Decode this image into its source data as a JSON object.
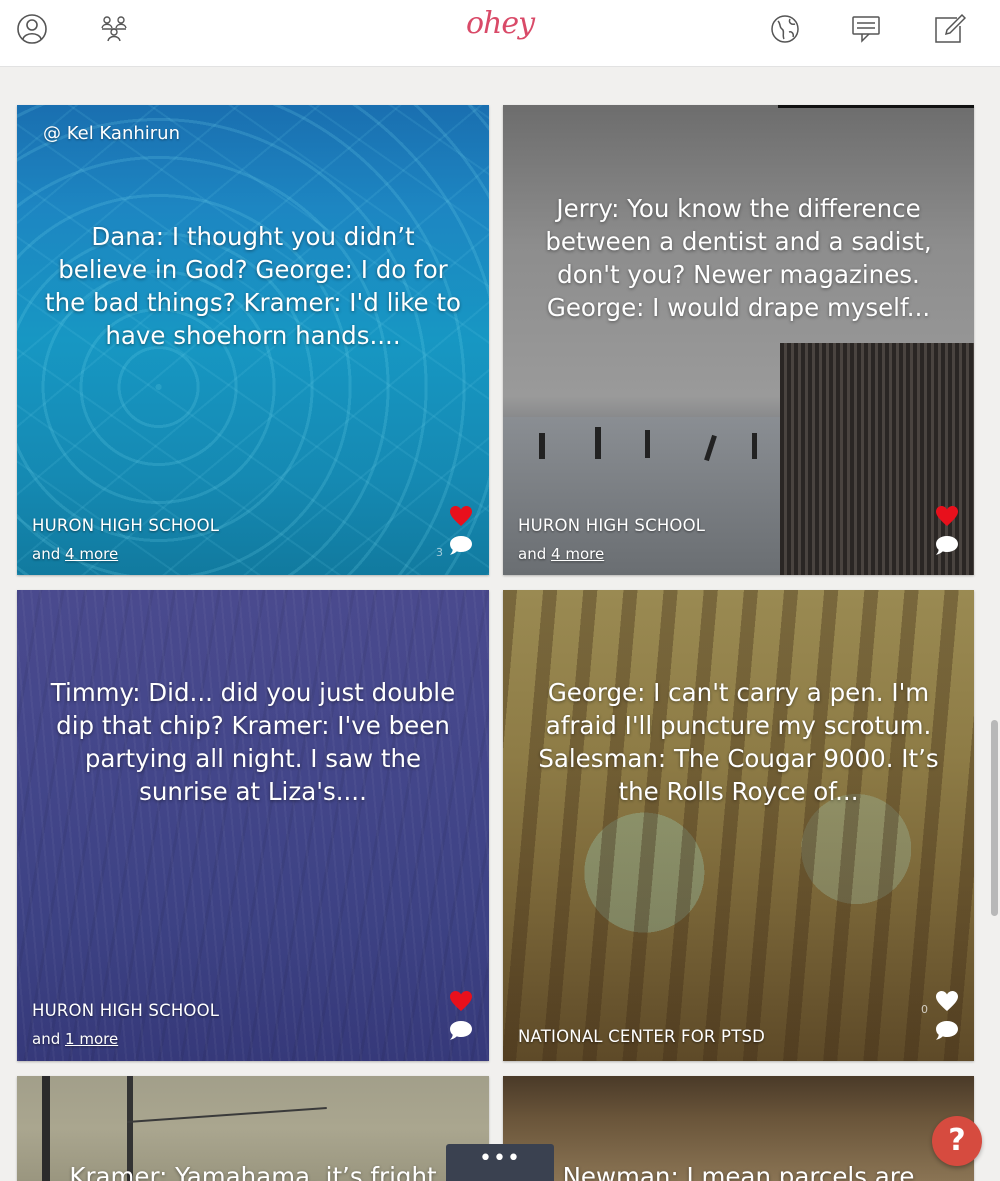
{
  "header": {
    "logo": "ohey",
    "icons": [
      "profile-icon",
      "groups-icon",
      "globe-icon",
      "messages-icon",
      "compose-icon"
    ]
  },
  "cards": [
    {
      "author": "@ Kel Kanhirun",
      "quote": "Dana: I thought you didn’t believe in God? George: I do for the bad things? Kramer: I'd like to have shoehorn hands....",
      "org": "HURON HIGH SCHOOL",
      "more_prefix": "and",
      "more_link": "4 more",
      "liked": true,
      "comment_count": "3"
    },
    {
      "quote": "Jerry: You know the difference between a dentist and a sadist, don't you? Newer magazines. George: I would drape myself...",
      "org": "HURON HIGH SCHOOL",
      "more_prefix": "and",
      "more_link": "4 more",
      "liked": true
    },
    {
      "quote": "Timmy: Did... did you just double dip that chip? Kramer: I've been partying all night. I saw the sunrise at Liza's....",
      "org": "HURON HIGH SCHOOL",
      "more_prefix": "and",
      "more_link": "1 more",
      "liked": true
    },
    {
      "quote": "George: I can't carry a pen. I'm afraid I'll puncture my scrotum. Salesman: The Cougar 9000. It’s the Rolls Royce of...",
      "org": "NATIONAL CENTER FOR PTSD",
      "liked": false,
      "like_count": "0"
    },
    {
      "quote": "Kramer: Yamahama, it’s fright"
    },
    {
      "quote": "Newman: I mean parcels are rarely"
    }
  ],
  "more_tab": "•••",
  "help": "?",
  "colors": {
    "brand": "#d94a68",
    "heart": "#e8101c",
    "help": "#d64b3f"
  }
}
